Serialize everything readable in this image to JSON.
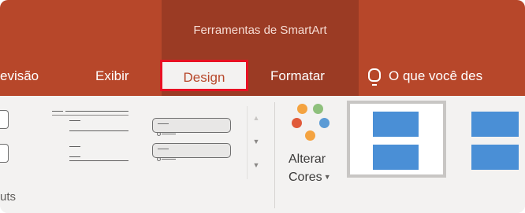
{
  "context_title": "Ferramentas de SmartArt",
  "tabs": {
    "revisao": "evisão",
    "exibir": "Exibir",
    "design": "Design",
    "formatar": "Formatar",
    "tellme": "O que você des"
  },
  "ribbon": {
    "alterar_label": "Alterar",
    "cores_label": "Cores",
    "layouts_group_label": "uts"
  },
  "colors": {
    "accent": "#b7472a",
    "context_band": "#9b3b24",
    "highlight_border": "#e81123",
    "smartart_blue": "#4a8fd6",
    "dot_green": "#8ec07c",
    "dot_blue": "#5b9bd5",
    "dot_red": "#e05a3a",
    "dot_orange": "#f4a340"
  },
  "icons": [
    "lightbulb-icon",
    "change-colors-icon",
    "scroll-up-icon",
    "scroll-down-icon",
    "expand-gallery-icon",
    "dropdown-arrow-icon"
  ]
}
